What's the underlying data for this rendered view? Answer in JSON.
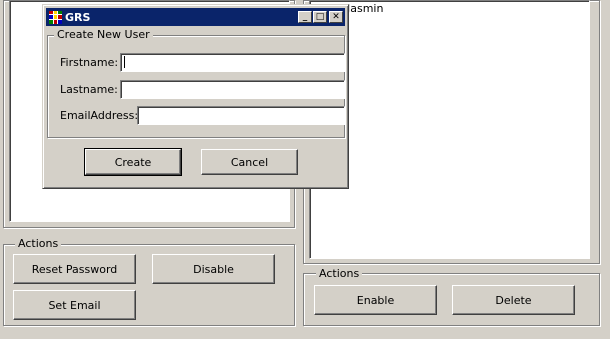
{
  "dialog": {
    "title": "GRS",
    "group_title": "Create New User",
    "fields": [
      {
        "label": "Firstname:",
        "value": ""
      },
      {
        "label": "Lastname:",
        "value": ""
      },
      {
        "label": "EmailAddress:",
        "value": ""
      }
    ],
    "buttons": {
      "create": "Create",
      "cancel": "Cancel"
    },
    "caption": {
      "minimize": "_",
      "maximize": "□",
      "close": "✕"
    }
  },
  "left_panel": {
    "actions_title": "Actions",
    "buttons": {
      "reset_password": "Reset Password",
      "disable": "Disable",
      "set_email": "Set Email"
    }
  },
  "right_panel": {
    "list_items": [
      "Jasmin"
    ],
    "actions_title": "Actions",
    "buttons": {
      "enable": "Enable",
      "delete": "Delete"
    }
  }
}
